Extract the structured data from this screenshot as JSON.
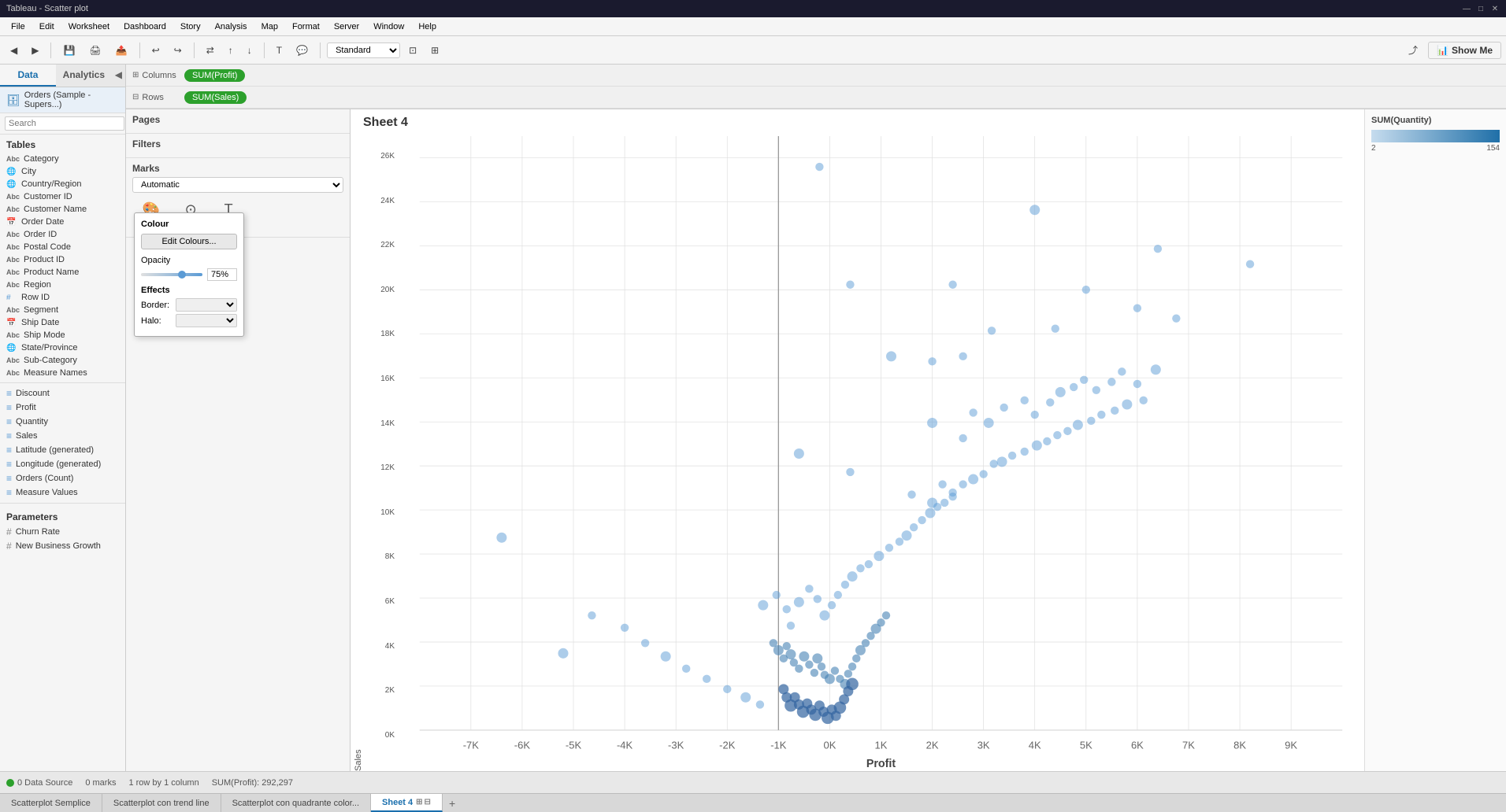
{
  "titleBar": {
    "title": "Tableau - Scatter plot",
    "minimize": "—",
    "maximize": "□",
    "close": "✕"
  },
  "menuBar": {
    "items": [
      "File",
      "Edit",
      "Worksheet",
      "Dashboard",
      "Story",
      "Analysis",
      "Map",
      "Format",
      "Server",
      "Window",
      "Help"
    ]
  },
  "toolbar": {
    "standardLabel": "Standard",
    "showMeLabel": "Show Me"
  },
  "sidebar": {
    "tab1": "Data",
    "tab2": "Analytics",
    "datasource": "Orders (Sample - Supers...)",
    "searchPlaceholder": "Search",
    "tablesTitle": "Tables",
    "items": [
      {
        "label": "Category",
        "type": "abc"
      },
      {
        "label": "City",
        "type": "globe"
      },
      {
        "label": "Country/Region",
        "type": "globe"
      },
      {
        "label": "Customer ID",
        "type": "abc"
      },
      {
        "label": "Customer Name",
        "type": "abc"
      },
      {
        "label": "Order Date",
        "type": "calendar"
      },
      {
        "label": "Order ID",
        "type": "abc"
      },
      {
        "label": "Postal Code",
        "type": "abc"
      },
      {
        "label": "Product ID",
        "type": "abc"
      },
      {
        "label": "Product Name",
        "type": "abc"
      },
      {
        "label": "Region",
        "type": "abc"
      },
      {
        "label": "Row ID",
        "type": "hash"
      },
      {
        "label": "Segment",
        "type": "abc"
      },
      {
        "label": "Ship Date",
        "type": "calendar"
      },
      {
        "label": "Ship Mode",
        "type": "abc"
      },
      {
        "label": "State/Province",
        "type": "globe"
      },
      {
        "label": "Sub-Category",
        "type": "abc"
      },
      {
        "label": "Measure Names",
        "type": "abc"
      }
    ],
    "measures": [
      {
        "label": "Discount",
        "type": "measure"
      },
      {
        "label": "Profit",
        "type": "measure"
      },
      {
        "label": "Quantity",
        "type": "measure"
      },
      {
        "label": "Sales",
        "type": "measure"
      },
      {
        "label": "Latitude (generated)",
        "type": "measure"
      },
      {
        "label": "Longitude (generated)",
        "type": "measure"
      },
      {
        "label": "Orders (Count)",
        "type": "measure"
      },
      {
        "label": "Measure Values",
        "type": "measure"
      }
    ],
    "parametersTitle": "Parameters",
    "parameters": [
      {
        "label": "Churn Rate",
        "type": "hash"
      },
      {
        "label": "New Business Growth",
        "type": "hash"
      }
    ]
  },
  "pages": {
    "title": "Pages"
  },
  "filters": {
    "title": "Filters"
  },
  "marks": {
    "title": "Marks",
    "type": "Automatic",
    "colourLabel": "Colour",
    "sizeLabel": "Size",
    "labelLabel": "Label"
  },
  "colourPopup": {
    "title": "Colour",
    "editBtn": "Edit Colours...",
    "opacityLabel": "Opacity",
    "opacityValue": "75%",
    "effectsLabel": "Effects",
    "borderLabel": "Border:",
    "haloLabel": "Halo:"
  },
  "shelves": {
    "columnsLabel": "Columns",
    "rowsLabel": "Rows",
    "columnPill": "SUM(Profit)",
    "rowPill": "SUM(Sales)"
  },
  "chart": {
    "title": "Sheet 4",
    "xAxisLabel": "Profit",
    "yAxisLabel": "Sales",
    "xTicks": [
      "-7K",
      "-6K",
      "-5K",
      "-4K",
      "-3K",
      "-2K",
      "-1K",
      "0K",
      "1K",
      "2K",
      "3K",
      "4K",
      "5K",
      "6K",
      "7K",
      "8K",
      "9K"
    ],
    "yTicks": [
      "0K",
      "2K",
      "4K",
      "6K",
      "8K",
      "10K",
      "12K",
      "14K",
      "16K",
      "18K",
      "20K",
      "22K",
      "24K",
      "26K"
    ]
  },
  "legend": {
    "title": "SUM(Quantity)",
    "minValue": "2",
    "maxValue": "154"
  },
  "statusBar": {
    "marks": "0 marks",
    "rows": "1 row by 1 column",
    "sumInfo": "SUM(Profit): 292,297"
  },
  "bottomTabs": {
    "tabs": [
      {
        "label": "Scatterplot Semplice",
        "active": false
      },
      {
        "label": "Scatterplot con trend line",
        "active": false
      },
      {
        "label": "Scatterplot con quadrante color...",
        "active": false
      },
      {
        "label": "Sheet 4",
        "active": true
      }
    ],
    "dataSource": "0 Data Source"
  }
}
